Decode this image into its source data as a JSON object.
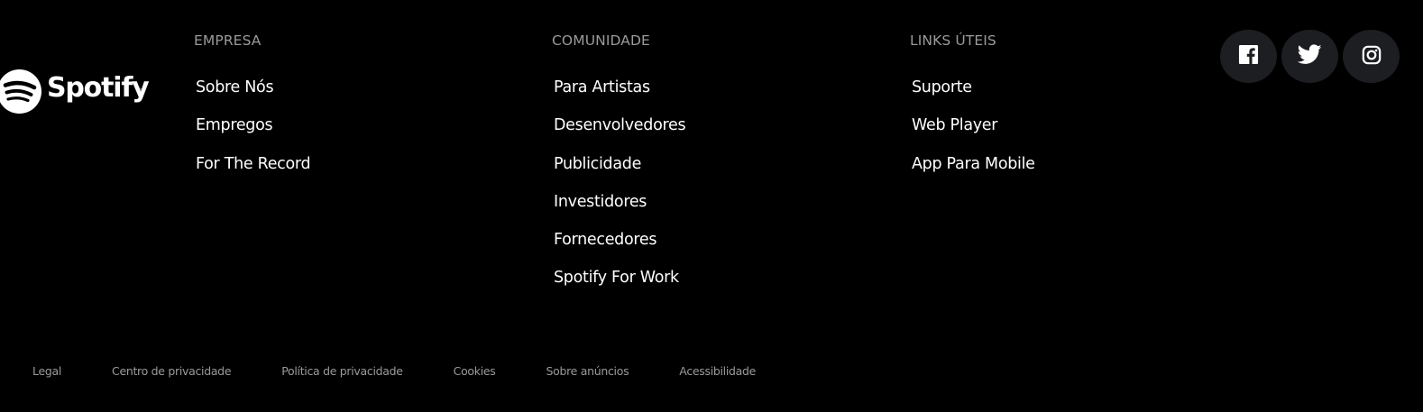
{
  "brand": {
    "name": "Spotify",
    "registered_mark": "®"
  },
  "columns": [
    {
      "title": "EMPRESA",
      "links": [
        "Sobre Nós",
        "Empregos",
        "For The Record"
      ]
    },
    {
      "title": "COMUNIDADE",
      "links": [
        "Para Artistas",
        "Desenvolvedores",
        "Publicidade",
        "Investidores",
        "Fornecedores",
        "Spotify For Work"
      ]
    },
    {
      "title": "LINKS ÚTEIS",
      "links": [
        "Suporte",
        "Web Player",
        "App Para Mobile"
      ]
    }
  ],
  "social": [
    {
      "icon": "facebook-icon"
    },
    {
      "icon": "twitter-icon"
    },
    {
      "icon": "instagram-icon"
    }
  ],
  "legal": [
    "Legal",
    "Centro de privacidade",
    "Política de privacidade",
    "Cookies",
    "Sobre anúncios",
    "Acessibilidade"
  ],
  "colors": {
    "background": "#000000",
    "text": "#ffffff",
    "muted": "#9a9a9a",
    "social_bg": "#1d1e21"
  }
}
